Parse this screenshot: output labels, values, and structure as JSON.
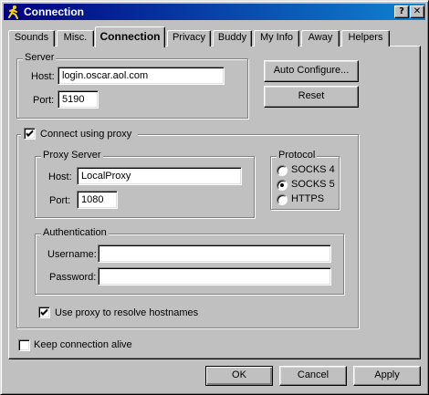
{
  "window": {
    "title": "Connection",
    "help_label": "?",
    "close_label": "✕"
  },
  "tabs": [
    {
      "label": "Sounds"
    },
    {
      "label": "Misc."
    },
    {
      "label": "Connection"
    },
    {
      "label": "Privacy"
    },
    {
      "label": "Buddy"
    },
    {
      "label": "My Info"
    },
    {
      "label": "Away"
    },
    {
      "label": "Helpers"
    }
  ],
  "active_tab": "Connection",
  "server": {
    "legend": "Server",
    "host_label": "Host:",
    "host_value": "login.oscar.aol.com",
    "port_label": "Port:",
    "port_value": "5190",
    "auto_configure_label": "Auto Configure...",
    "reset_label": "Reset"
  },
  "proxy": {
    "checkbox_label": "Connect using proxy",
    "checked": true,
    "server": {
      "legend": "Proxy Server",
      "host_label": "Host:",
      "host_value": "LocalProxy",
      "port_label": "Port:",
      "port_value": "1080"
    },
    "protocol": {
      "legend": "Protocol",
      "options": [
        "SOCKS 4",
        "SOCKS 5",
        "HTTPS"
      ],
      "selected": "SOCKS 5"
    },
    "auth": {
      "legend": "Authentication",
      "username_label": "Username:",
      "username_value": "",
      "password_label": "Password:",
      "password_value": ""
    },
    "resolve_label": "Use proxy to resolve hostnames",
    "resolve_checked": true
  },
  "keepalive": {
    "label": "Keep connection alive",
    "checked": false
  },
  "footer": {
    "ok_label": "OK",
    "cancel_label": "Cancel",
    "apply_label": "Apply"
  },
  "colors": {
    "titlebar_start": "#000080",
    "titlebar_end": "#1084d0",
    "face": "#c0c0c0"
  },
  "icons": {
    "app": "aim-running-man-icon",
    "check": "checkmark-icon"
  }
}
